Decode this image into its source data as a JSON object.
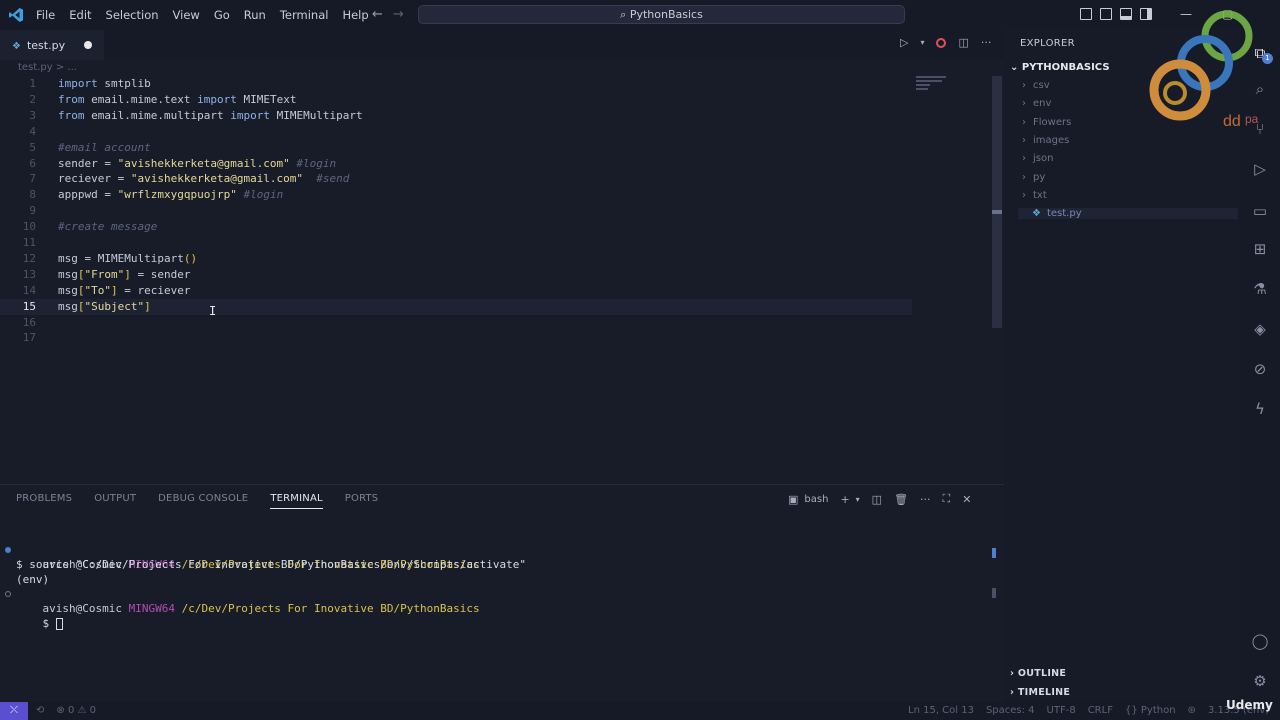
{
  "menu": [
    "File",
    "Edit",
    "Selection",
    "View",
    "Go",
    "Run",
    "Terminal",
    "Help"
  ],
  "search": {
    "label": "PythonBasics"
  },
  "tab": {
    "name": "test.py"
  },
  "breadcrumb": "test.py > ...",
  "editor": {
    "lines": [
      {
        "n": "1",
        "html": "<span class=\"kw\">import</span> smtplib"
      },
      {
        "n": "2",
        "html": "<span class=\"kw\">from</span> email.mime.text <span class=\"kw\">import</span> MIMEText"
      },
      {
        "n": "3",
        "html": "<span class=\"kw\">from</span> email.mime.multipart <span class=\"kw\">import</span> MIMEMultipart"
      },
      {
        "n": "4",
        "html": ""
      },
      {
        "n": "5",
        "html": "<span class=\"cm\">#email account</span>"
      },
      {
        "n": "6",
        "html": "sender = <span class=\"str\">\"avishekkerketa@gmail.com\"</span> <span class=\"cm\">#login</span>"
      },
      {
        "n": "7",
        "html": "reciever = <span class=\"str\">\"avishekkerketa@gmail.com\"</span>  <span class=\"cm\">#send</span>"
      },
      {
        "n": "8",
        "html": "apppwd = <span class=\"str\">\"wrflzmxygqpuojrp\"</span> <span class=\"cm\">#login</span>"
      },
      {
        "n": "9",
        "html": ""
      },
      {
        "n": "10",
        "html": "<span class=\"cm\">#create message</span>"
      },
      {
        "n": "11",
        "html": ""
      },
      {
        "n": "12",
        "html": "msg = MIMEMultipart<span class=\"br\">()</span>"
      },
      {
        "n": "13",
        "html": "msg<span class=\"br\">[</span><span class=\"str\">\"From\"</span><span class=\"br\">]</span> = sender"
      },
      {
        "n": "14",
        "html": "msg<span class=\"br\">[</span><span class=\"str\">\"To\"</span><span class=\"br\">]</span> = reciever"
      },
      {
        "n": "15",
        "html": "msg<span class=\"br\">[</span><span class=\"str\">\"Subject\"</span><span class=\"br\">]</span>"
      },
      {
        "n": "16",
        "html": ""
      },
      {
        "n": "17",
        "html": ""
      }
    ],
    "current_line": "15"
  },
  "panel": {
    "tabs": [
      "PROBLEMS",
      "OUTPUT",
      "DEBUG CONSOLE",
      "TERMINAL",
      "PORTS"
    ],
    "active_tab": "TERMINAL",
    "shell": "bash"
  },
  "terminal": {
    "user": "avish@Cosmic",
    "ming": "MINGW64",
    "path": "/c/Dev/Projects For Inovative BD/PythonBasics",
    "cmd": "$ source \"C:/Dev/Projects For Inovative BD/PythonBasics/env/Scripts/activate\"",
    "env": "(env)",
    "prompt": "$"
  },
  "explorer": {
    "title": "EXPLORER",
    "root": "PYTHONBASICS",
    "folders": [
      "csv",
      "env",
      "Flowers",
      "images",
      "json",
      "py",
      "txt"
    ],
    "file": "test.py",
    "outline": "OUTLINE",
    "timeline": "TIMELINE"
  },
  "status": {
    "problems": "0 ⚠ 0",
    "position": "Ln 15, Col 13",
    "spaces": "Spaces: 4",
    "encoding": "UTF-8",
    "eol": "CRLF",
    "language": "Python",
    "version": "3.13.5 (env)"
  },
  "badge": "1",
  "watermark": "Udemy"
}
